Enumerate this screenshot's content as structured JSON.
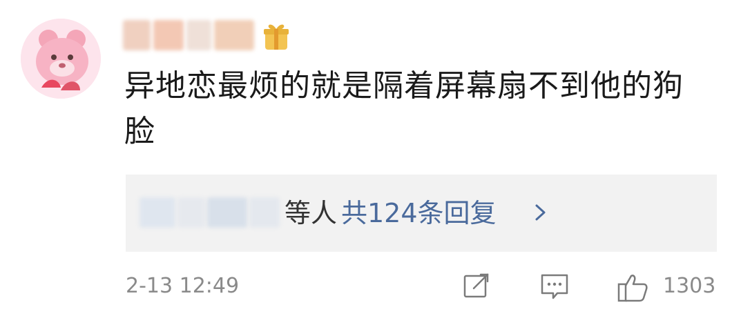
{
  "comment": {
    "text": "异地恋最烦的就是隔着屏幕扇不到他的狗脸",
    "timestamp": "2-13 12:49",
    "like_count": "1303"
  },
  "replies": {
    "suffix": "等人",
    "count_label": "共124条回复"
  },
  "icons": {
    "share": "share-icon",
    "comment": "comment-icon",
    "like": "thumbs-up-icon",
    "chevron": "chevron-right-icon",
    "badge": "gift-badge-icon"
  },
  "colors": {
    "link": "#4a6a9c",
    "meta": "#8a8a8a",
    "reply_bg": "#f2f2f2"
  }
}
